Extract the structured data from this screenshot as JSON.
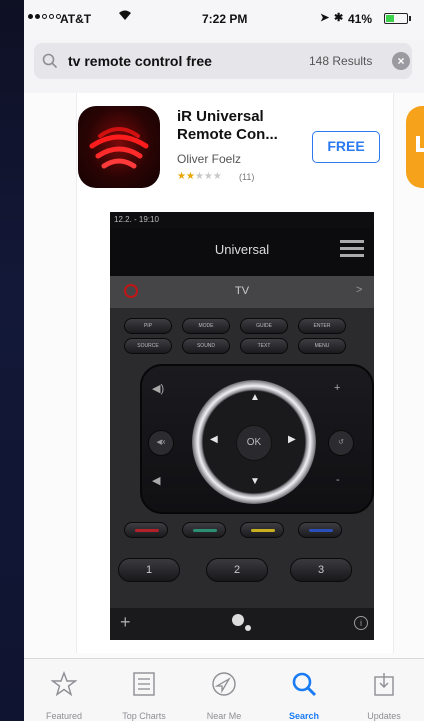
{
  "status_bar": {
    "carrier": "AT&T",
    "time": "7:22 PM",
    "battery": "41%",
    "battery_level": 0.41
  },
  "search": {
    "query": "tv remote control free",
    "results": "148 Results"
  },
  "app": {
    "name": "iR Universal Remote Con...",
    "developer": "Oliver Foelz",
    "rating_stars": 2,
    "rating_count": "(11)",
    "price_label": "FREE"
  },
  "remote_screenshot": {
    "status": "12.2. - 19:10",
    "title": "Universal",
    "device": "TV",
    "ok": "OK",
    "buttons_row1": [
      "PIP",
      "MODE",
      "GUIDE",
      "ENTER"
    ],
    "buttons_row2": [
      "SOURCE",
      "SOUND",
      "TEXT",
      "MENU"
    ],
    "numbers": [
      "1",
      "2",
      "3"
    ]
  },
  "tabs": [
    {
      "label": "Featured",
      "icon": "star-icon",
      "active": false
    },
    {
      "label": "Top Charts",
      "icon": "list-icon",
      "active": false
    },
    {
      "label": "Near Me",
      "icon": "location-arrow-icon",
      "active": false
    },
    {
      "label": "Search",
      "icon": "search-icon",
      "active": true
    },
    {
      "label": "Updates",
      "icon": "download-tray-icon",
      "active": false
    }
  ],
  "colors": {
    "accent": "#1a7cf5",
    "free_button": "#2b7af0",
    "next_app_icon": "#f6a21b"
  }
}
